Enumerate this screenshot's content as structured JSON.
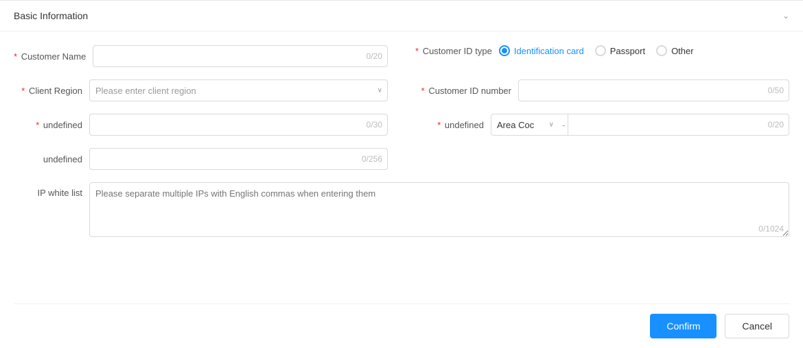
{
  "section": {
    "title": "Basic Information",
    "collapse_icon": "chevron-up"
  },
  "fields": {
    "customer_name": {
      "label": "Customer Name",
      "required": true,
      "value": "",
      "char_count": "0/20",
      "placeholder": ""
    },
    "customer_id_type": {
      "label": "Customer ID type",
      "required": true,
      "options": [
        {
          "value": "id_card",
          "label": "Identification card",
          "selected": true
        },
        {
          "value": "passport",
          "label": "Passport",
          "selected": false
        },
        {
          "value": "other",
          "label": "Other",
          "selected": false
        }
      ]
    },
    "client_region": {
      "label": "Client Region",
      "required": true,
      "placeholder": "Please enter client region"
    },
    "customer_id_number": {
      "label": "Customer ID number",
      "required": true,
      "value": "",
      "char_count": "0/50"
    },
    "undefined_field1": {
      "label": "undefined",
      "required": true,
      "value": "",
      "char_count": "0/30"
    },
    "undefined_field2": {
      "label": "undefined",
      "required": true,
      "area_code_placeholder": "Area Coc",
      "phone_value": "",
      "phone_char_count": "0/20"
    },
    "undefined_field3": {
      "label": "undefined",
      "required": false,
      "value": "",
      "char_count": "0/256"
    },
    "ip_whitelist": {
      "label": "IP white list",
      "required": false,
      "placeholder": "Please separate multiple IPs with English commas when entering them",
      "char_count": "0/1024"
    }
  },
  "footer": {
    "confirm_label": "Confirm",
    "cancel_label": "Cancel"
  }
}
